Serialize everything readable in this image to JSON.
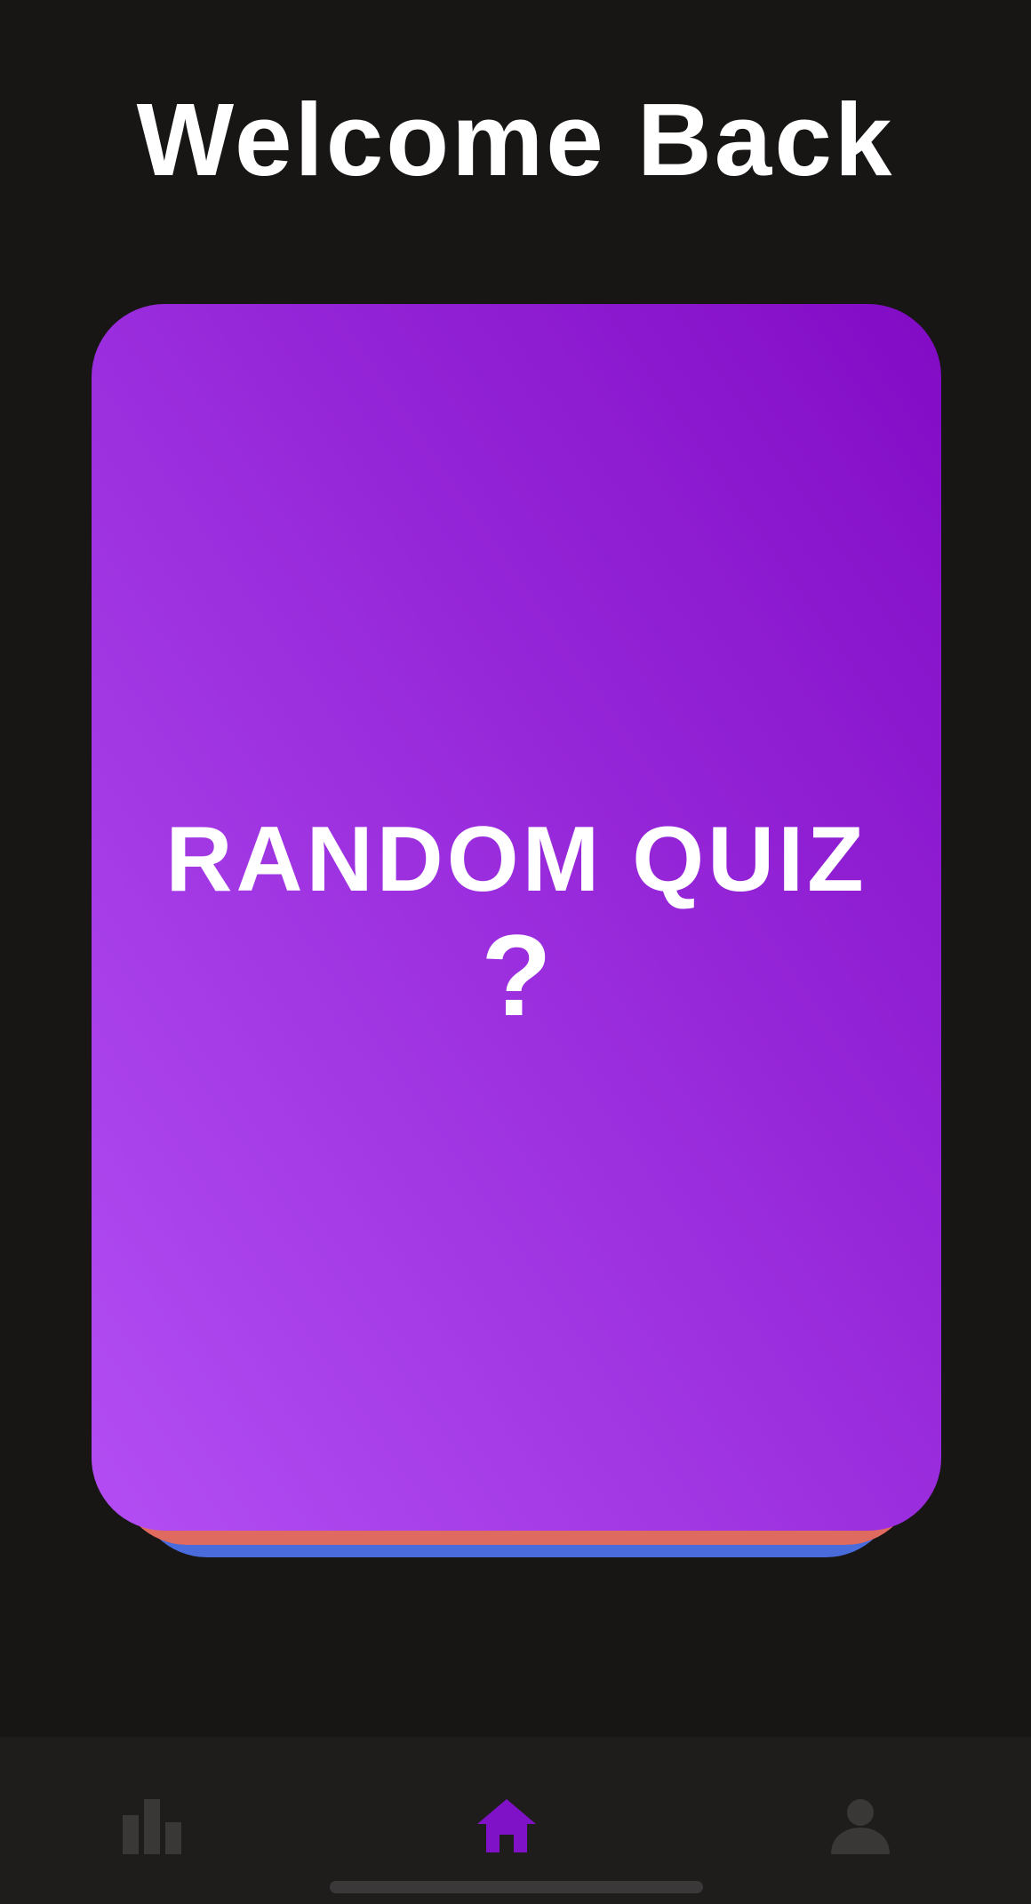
{
  "header": {
    "title": "Welcome Back"
  },
  "quiz_card": {
    "title": "RANDOM QUIZ",
    "icon_glyph": "?",
    "gradient_colors": [
      "#b34ef3",
      "#9a2ddd",
      "#820bc5"
    ],
    "stack_colors": [
      "#df6a5f",
      "#4a6bdb"
    ]
  },
  "tab_bar": {
    "tabs": [
      {
        "name": "stats",
        "icon": "bar-chart-icon",
        "active": false
      },
      {
        "name": "home",
        "icon": "home-icon",
        "active": true
      },
      {
        "name": "profile",
        "icon": "person-icon",
        "active": false
      }
    ],
    "active_color": "#7f12c6",
    "inactive_color": "#3a3737"
  },
  "colors": {
    "background": "#181515",
    "tab_bar_background": "#1f1c1c",
    "text": "#ffffff"
  }
}
